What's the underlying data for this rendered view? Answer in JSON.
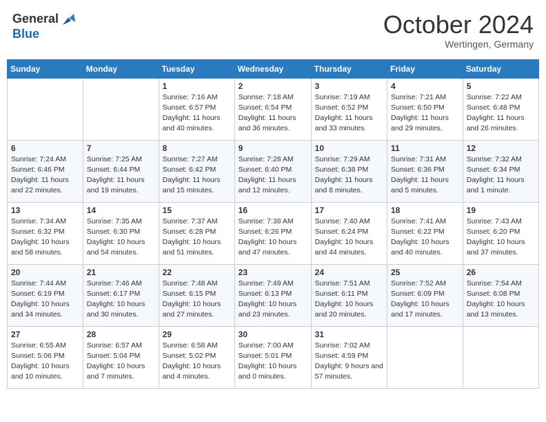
{
  "header": {
    "logo_general": "General",
    "logo_blue": "Blue",
    "month_title": "October 2024",
    "location": "Wertingen, Germany"
  },
  "days_of_week": [
    "Sunday",
    "Monday",
    "Tuesday",
    "Wednesday",
    "Thursday",
    "Friday",
    "Saturday"
  ],
  "weeks": [
    [
      {
        "day": "",
        "sunrise": "",
        "sunset": "",
        "daylight": ""
      },
      {
        "day": "",
        "sunrise": "",
        "sunset": "",
        "daylight": ""
      },
      {
        "day": "1",
        "sunrise": "Sunrise: 7:16 AM",
        "sunset": "Sunset: 6:57 PM",
        "daylight": "Daylight: 11 hours and 40 minutes."
      },
      {
        "day": "2",
        "sunrise": "Sunrise: 7:18 AM",
        "sunset": "Sunset: 6:54 PM",
        "daylight": "Daylight: 11 hours and 36 minutes."
      },
      {
        "day": "3",
        "sunrise": "Sunrise: 7:19 AM",
        "sunset": "Sunset: 6:52 PM",
        "daylight": "Daylight: 11 hours and 33 minutes."
      },
      {
        "day": "4",
        "sunrise": "Sunrise: 7:21 AM",
        "sunset": "Sunset: 6:50 PM",
        "daylight": "Daylight: 11 hours and 29 minutes."
      },
      {
        "day": "5",
        "sunrise": "Sunrise: 7:22 AM",
        "sunset": "Sunset: 6:48 PM",
        "daylight": "Daylight: 11 hours and 26 minutes."
      }
    ],
    [
      {
        "day": "6",
        "sunrise": "Sunrise: 7:24 AM",
        "sunset": "Sunset: 6:46 PM",
        "daylight": "Daylight: 11 hours and 22 minutes."
      },
      {
        "day": "7",
        "sunrise": "Sunrise: 7:25 AM",
        "sunset": "Sunset: 6:44 PM",
        "daylight": "Daylight: 11 hours and 19 minutes."
      },
      {
        "day": "8",
        "sunrise": "Sunrise: 7:27 AM",
        "sunset": "Sunset: 6:42 PM",
        "daylight": "Daylight: 11 hours and 15 minutes."
      },
      {
        "day": "9",
        "sunrise": "Sunrise: 7:28 AM",
        "sunset": "Sunset: 6:40 PM",
        "daylight": "Daylight: 11 hours and 12 minutes."
      },
      {
        "day": "10",
        "sunrise": "Sunrise: 7:29 AM",
        "sunset": "Sunset: 6:38 PM",
        "daylight": "Daylight: 11 hours and 8 minutes."
      },
      {
        "day": "11",
        "sunrise": "Sunrise: 7:31 AM",
        "sunset": "Sunset: 6:36 PM",
        "daylight": "Daylight: 11 hours and 5 minutes."
      },
      {
        "day": "12",
        "sunrise": "Sunrise: 7:32 AM",
        "sunset": "Sunset: 6:34 PM",
        "daylight": "Daylight: 11 hours and 1 minute."
      }
    ],
    [
      {
        "day": "13",
        "sunrise": "Sunrise: 7:34 AM",
        "sunset": "Sunset: 6:32 PM",
        "daylight": "Daylight: 10 hours and 58 minutes."
      },
      {
        "day": "14",
        "sunrise": "Sunrise: 7:35 AM",
        "sunset": "Sunset: 6:30 PM",
        "daylight": "Daylight: 10 hours and 54 minutes."
      },
      {
        "day": "15",
        "sunrise": "Sunrise: 7:37 AM",
        "sunset": "Sunset: 6:28 PM",
        "daylight": "Daylight: 10 hours and 51 minutes."
      },
      {
        "day": "16",
        "sunrise": "Sunrise: 7:38 AM",
        "sunset": "Sunset: 6:26 PM",
        "daylight": "Daylight: 10 hours and 47 minutes."
      },
      {
        "day": "17",
        "sunrise": "Sunrise: 7:40 AM",
        "sunset": "Sunset: 6:24 PM",
        "daylight": "Daylight: 10 hours and 44 minutes."
      },
      {
        "day": "18",
        "sunrise": "Sunrise: 7:41 AM",
        "sunset": "Sunset: 6:22 PM",
        "daylight": "Daylight: 10 hours and 40 minutes."
      },
      {
        "day": "19",
        "sunrise": "Sunrise: 7:43 AM",
        "sunset": "Sunset: 6:20 PM",
        "daylight": "Daylight: 10 hours and 37 minutes."
      }
    ],
    [
      {
        "day": "20",
        "sunrise": "Sunrise: 7:44 AM",
        "sunset": "Sunset: 6:19 PM",
        "daylight": "Daylight: 10 hours and 34 minutes."
      },
      {
        "day": "21",
        "sunrise": "Sunrise: 7:46 AM",
        "sunset": "Sunset: 6:17 PM",
        "daylight": "Daylight: 10 hours and 30 minutes."
      },
      {
        "day": "22",
        "sunrise": "Sunrise: 7:48 AM",
        "sunset": "Sunset: 6:15 PM",
        "daylight": "Daylight: 10 hours and 27 minutes."
      },
      {
        "day": "23",
        "sunrise": "Sunrise: 7:49 AM",
        "sunset": "Sunset: 6:13 PM",
        "daylight": "Daylight: 10 hours and 23 minutes."
      },
      {
        "day": "24",
        "sunrise": "Sunrise: 7:51 AM",
        "sunset": "Sunset: 6:11 PM",
        "daylight": "Daylight: 10 hours and 20 minutes."
      },
      {
        "day": "25",
        "sunrise": "Sunrise: 7:52 AM",
        "sunset": "Sunset: 6:09 PM",
        "daylight": "Daylight: 10 hours and 17 minutes."
      },
      {
        "day": "26",
        "sunrise": "Sunrise: 7:54 AM",
        "sunset": "Sunset: 6:08 PM",
        "daylight": "Daylight: 10 hours and 13 minutes."
      }
    ],
    [
      {
        "day": "27",
        "sunrise": "Sunrise: 6:55 AM",
        "sunset": "Sunset: 5:06 PM",
        "daylight": "Daylight: 10 hours and 10 minutes."
      },
      {
        "day": "28",
        "sunrise": "Sunrise: 6:57 AM",
        "sunset": "Sunset: 5:04 PM",
        "daylight": "Daylight: 10 hours and 7 minutes."
      },
      {
        "day": "29",
        "sunrise": "Sunrise: 6:58 AM",
        "sunset": "Sunset: 5:02 PM",
        "daylight": "Daylight: 10 hours and 4 minutes."
      },
      {
        "day": "30",
        "sunrise": "Sunrise: 7:00 AM",
        "sunset": "Sunset: 5:01 PM",
        "daylight": "Daylight: 10 hours and 0 minutes."
      },
      {
        "day": "31",
        "sunrise": "Sunrise: 7:02 AM",
        "sunset": "Sunset: 4:59 PM",
        "daylight": "Daylight: 9 hours and 57 minutes."
      },
      {
        "day": "",
        "sunrise": "",
        "sunset": "",
        "daylight": ""
      },
      {
        "day": "",
        "sunrise": "",
        "sunset": "",
        "daylight": ""
      }
    ]
  ]
}
